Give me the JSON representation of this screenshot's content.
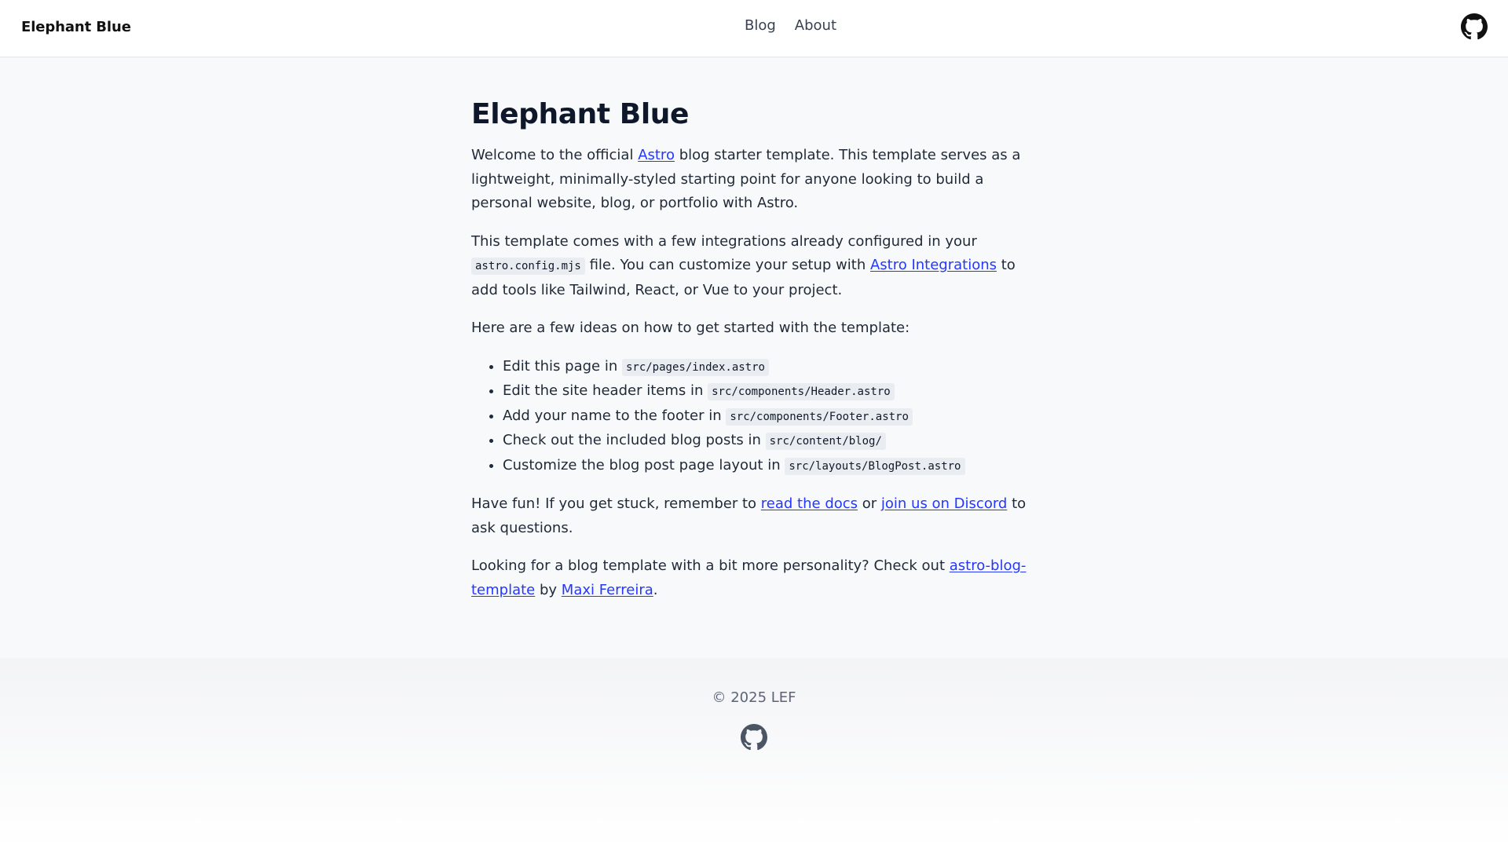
{
  "header": {
    "brand": "Elephant Blue",
    "nav": [
      {
        "label": "Blog"
      },
      {
        "label": "About"
      }
    ],
    "github_icon": "github-icon"
  },
  "main": {
    "title": "Elephant Blue",
    "intro": {
      "before_link": "Welcome to the official ",
      "link": "Astro",
      "after_link": " blog starter template. This template serves as a lightweight, minimally-styled starting point for anyone looking to build a personal website, blog, or portfolio with Astro."
    },
    "integrations": {
      "before_code": "This template comes with a few integrations already configured in your ",
      "code": "astro.config.mjs",
      "middle": " file. You can customize your setup with ",
      "link": "Astro Integrations",
      "after_link": " to add tools like Tailwind, React, or Vue to your project."
    },
    "ideas_heading": "Here are a few ideas on how to get started with the template:",
    "ideas": [
      {
        "text": "Edit this page in ",
        "code": "src/pages/index.astro"
      },
      {
        "text": "Edit the site header items in ",
        "code": "src/components/Header.astro"
      },
      {
        "text": "Add your name to the footer in ",
        "code": "src/components/Footer.astro"
      },
      {
        "text": "Check out the included blog posts in ",
        "code": "src/content/blog/"
      },
      {
        "text": "Customize the blog post page layout in ",
        "code": "src/layouts/BlogPost.astro"
      }
    ],
    "fun": {
      "before": "Have fun! If you get stuck, remember to ",
      "link1": "read the docs",
      "middle": " or ",
      "link2": "join us on Discord",
      "after": " to ask questions."
    },
    "personality": {
      "before": "Looking for a blog template with a bit more personality? Check out ",
      "link1": "astro-blog-template",
      "middle": " by ",
      "link2": "Maxi Ferreira",
      "after": "."
    },
    "link_color": "#2337ff"
  },
  "footer": {
    "copyright": "© 2025 LEF",
    "github_icon": "github-icon"
  }
}
